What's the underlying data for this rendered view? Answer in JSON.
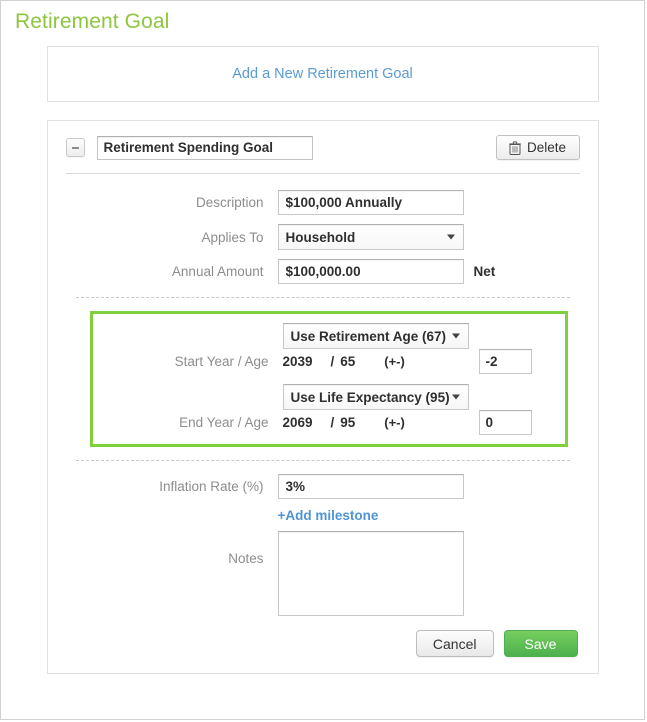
{
  "page": {
    "title": "Retirement Goal",
    "title_color": "#8cc63f"
  },
  "add_panel": {
    "link_label": "Add a New Retirement Goal",
    "link_color": "#5a9bd5"
  },
  "goal": {
    "collapse_icon": "minus-icon",
    "name_value": "Retirement Spending Goal",
    "name_placeholder": "",
    "delete_label": "Delete",
    "delete_icon": "trash-icon",
    "fields": {
      "description_label": "Description",
      "description_value": "$100,000 Annually",
      "applies_to_label": "Applies To",
      "applies_to_value": "Household",
      "annual_amount_label": "Annual Amount",
      "annual_amount_value": "$100,000.00",
      "annual_amount_suffix": "Net",
      "inflation_label": "Inflation Rate (%)",
      "inflation_value": "3%",
      "notes_label": "Notes",
      "notes_value": "",
      "notes_placeholder": ""
    },
    "date_block": {
      "highlight_color": "#7ed03c",
      "start": {
        "mode_value": "Use Retirement Age (67)",
        "label": "Start Year / Age",
        "year": "2039",
        "separator": "/",
        "age": "65",
        "offset_label": "(+-)",
        "offset_value": "-2"
      },
      "end": {
        "mode_value": "Use Life Expectancy (95)",
        "label": "End Year / Age",
        "year": "2069",
        "separator": "/",
        "age": "95",
        "offset_label": "(+-)",
        "offset_value": "0"
      }
    },
    "milestone": {
      "plus": "+",
      "label": "Add milestone",
      "color": "#4f94d4"
    },
    "footer": {
      "cancel_label": "Cancel",
      "save_label": "Save",
      "save_color": "#5cb85c"
    }
  }
}
